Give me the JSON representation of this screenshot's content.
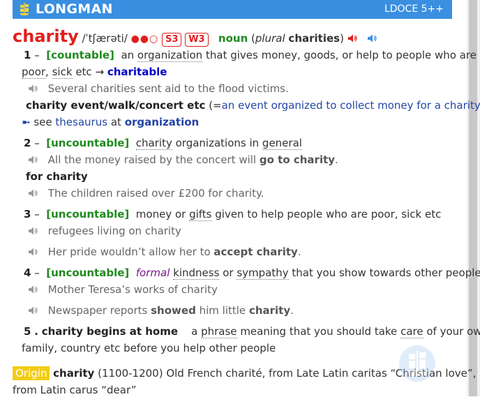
{
  "header": {
    "brand": "LONGMAN",
    "edition": "LDOCE 5++"
  },
  "entry": {
    "headword": "charity",
    "pronunciation": "/ˈtʃærəti/",
    "frequency": "●●○",
    "spoken_badge": "S3",
    "written_badge": "W3",
    "pos": "noun",
    "plural_label": "plural",
    "plural_form": "charities"
  },
  "senses": [
    {
      "num": "1",
      "dash": "–",
      "gram": "[countable]",
      "def_a": "an",
      "def_b": "organization",
      "def_c": "that gives money, goods, or help to people who are",
      "def_d": "poor",
      "def_e": ",",
      "def_f": "sick",
      "def_g": "etc",
      "arrow": "→",
      "xref": "charitable",
      "examples": [
        "Several charities sent aid to the flood victims."
      ],
      "collocation": "charity event/walk/concert etc",
      "collocation_open": "(=",
      "collocation_gloss": "an event organized to collect money for a charity",
      "collocation_close": ")",
      "see_pointer": "➼",
      "see_label": "see",
      "see_link": "thesaurus",
      "see_at": "at",
      "see_target": "organization"
    },
    {
      "num": "2",
      "dash": "–",
      "gram": "[uncountable]",
      "def_a": "charity",
      "def_b": "organizations in",
      "def_c": "general",
      "ex1_a": "All the money raised by the concert will",
      "ex1_b": "go to charity",
      "ex1_c": ".",
      "phrase": "for charity",
      "ex2": "The children raised over £200 for charity."
    },
    {
      "num": "3",
      "dash": "–",
      "gram": "[uncountable]",
      "def_a": "money or",
      "def_b": "gifts",
      "def_c": "given to help people who are poor, sick etc",
      "ex1": "refugees living on charity",
      "ex2_a": "Her pride wouldn’t allow her to",
      "ex2_b": "accept charity",
      "ex2_c": "."
    },
    {
      "num": "4",
      "dash": "–",
      "gram": "[uncountable]",
      "register": "formal",
      "def_a": "kindness",
      "def_b": "or",
      "def_c": "sympathy",
      "def_d": "that you show towards other people",
      "ex1": "Mother Teresa’s works of charity",
      "ex2_a": "Newspaper reports",
      "ex2_b": "showed",
      "ex2_c": "him little",
      "ex2_d": "charity",
      "ex2_e": "."
    },
    {
      "num": "5",
      "dot": ".",
      "phrase": "charity begins at home",
      "def_a": "a",
      "def_b": "phrase",
      "def_c": "meaning that you should take",
      "def_d": "care",
      "def_e": "of your own",
      "def_f": "family, country etc before you help other people"
    }
  ],
  "origin": {
    "tag": "Origin",
    "word": "charity",
    "text_a": "(1100-1200) Old French charité, from Late Latin caritas “Christian love”,",
    "text_b": "from Latin carus “dear”"
  },
  "colors": {
    "header": "#3a8fe0",
    "headword": "#e0201e",
    "gram": "#1f8a1f",
    "link": "#2345a8",
    "origin": "#f2cc13"
  },
  "icons": [
    "longman-ship-icon",
    "speaker-icon",
    "speaker-red-icon",
    "speaker-blue-icon",
    "watermark-ship-icon"
  ]
}
